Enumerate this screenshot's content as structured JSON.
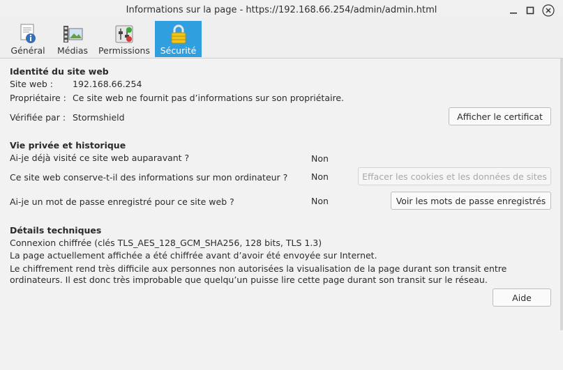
{
  "window": {
    "title": "Informations sur la page - https://192.168.66.254/admin/admin.html",
    "controls": [
      "minimize-icon",
      "maximize-icon",
      "close-icon"
    ]
  },
  "tabs": [
    {
      "label": "Général",
      "icon": "general-info-icon",
      "active": false
    },
    {
      "label": "Médias",
      "icon": "media-icon",
      "active": false
    },
    {
      "label": "Permissions",
      "icon": "permissions-icon",
      "active": false
    },
    {
      "label": "Sécurité",
      "icon": "padlock-icon",
      "active": true
    }
  ],
  "identity": {
    "heading": "Identité du site web",
    "site_label": "Site web :",
    "site_value": "192.168.66.254",
    "owner_label": "Propriétaire :",
    "owner_value": "Ce site web ne fournit pas d’informations sur son propriétaire.",
    "verified_label": "Vérifiée par :",
    "verified_value": "Stormshield",
    "cert_button": "Afficher le certificat"
  },
  "privacy": {
    "heading": "Vie privée et historique",
    "q1": "Ai-je déjà visité ce site web auparavant ?",
    "a1": "Non",
    "q2": "Ce site web conserve-t-il des informations sur mon ordinateur ?",
    "a2": "Non",
    "clear_button": "Effacer les cookies et les données de sites",
    "q3": "Ai-je un mot de passe enregistré pour ce site web ?",
    "a3": "Non",
    "passwords_button": "Voir les mots de passe enregistrés"
  },
  "technical": {
    "heading": "Détails techniques",
    "line1": "Connexion chiffrée (clés TLS_AES_128_GCM_SHA256, 128 bits, TLS 1.3)",
    "line2": "La page actuellement affichée a été chiffrée avant d’avoir été envoyée sur Internet.",
    "line3": "Le chiffrement rend très difficile aux personnes non autorisées la visualisation de la page durant son transit entre ordinateurs. Il est donc très improbable que quelqu’un puisse lire cette page durant son transit sur le réseau."
  },
  "help_button": "Aide",
  "colors": {
    "active_tab": "#2f9fe0",
    "background": "#f2f2f2"
  }
}
